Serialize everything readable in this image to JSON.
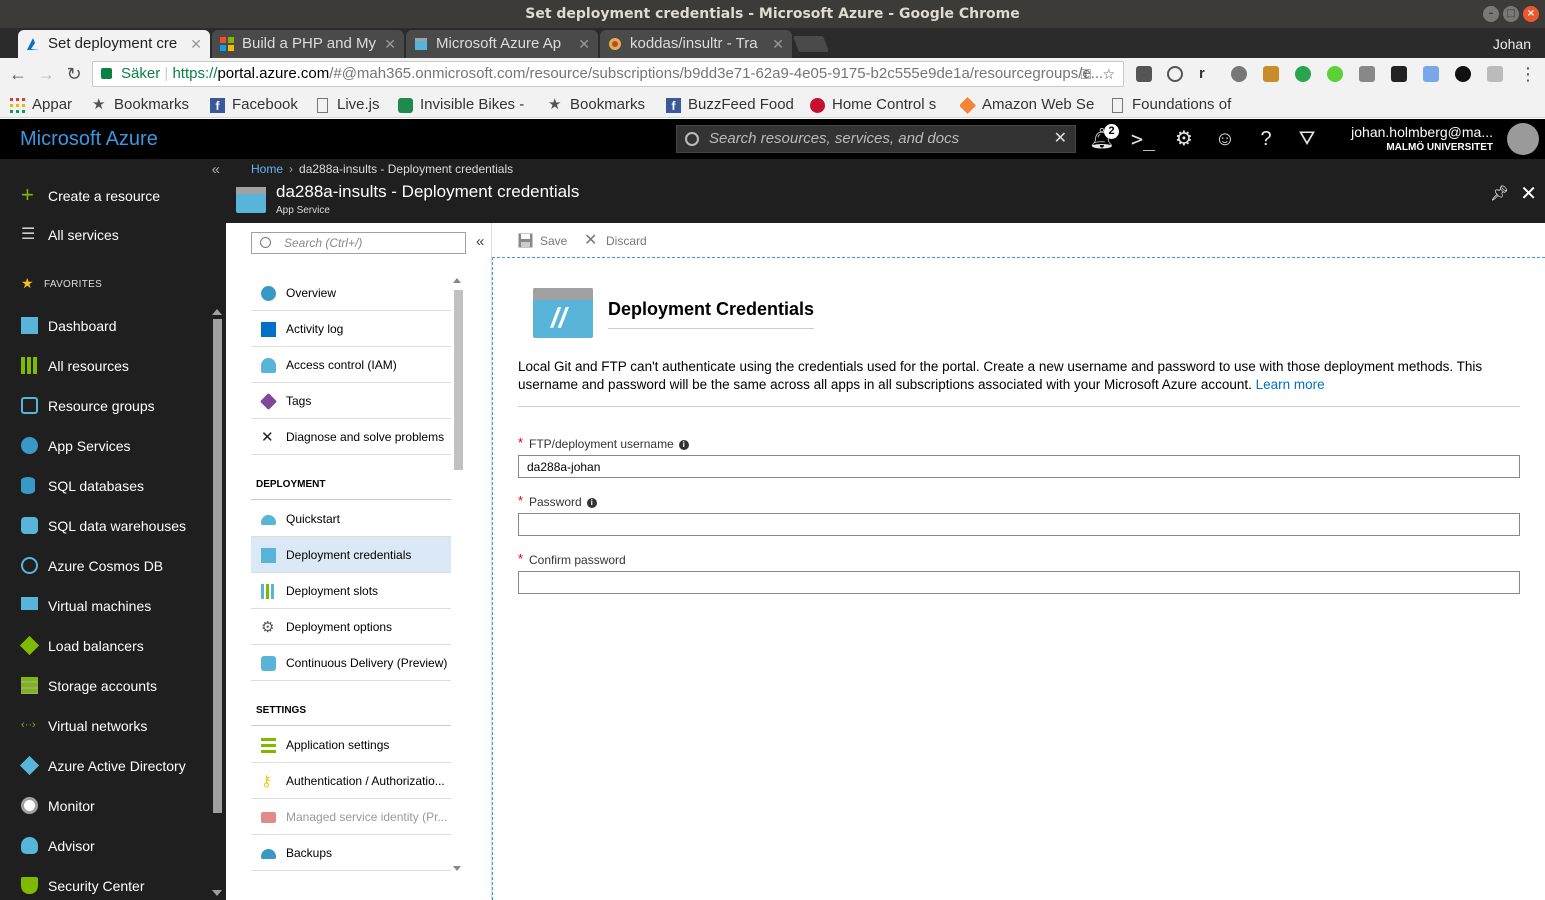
{
  "window": {
    "title": "Set deployment credentials - Microsoft Azure - Google Chrome"
  },
  "tabs": [
    {
      "label": "Set deployment cre",
      "active": true
    },
    {
      "label": "Build a PHP and My",
      "active": false
    },
    {
      "label": "Microsoft Azure Ap",
      "active": false
    },
    {
      "label": "koddas/insultr - Tra",
      "active": false
    }
  ],
  "profile": "Johan",
  "address": {
    "secure_label": "Säker",
    "scheme": "https://",
    "host": "portal.azure.com",
    "path": "/#@mah365.onmicrosoft.com/resource/subscriptions/b9dd3e71-62a9-4e05-9175-b2c555e9de1a/resourcegroups/e..."
  },
  "bookmarks": [
    {
      "label": "Appar",
      "icon": "apps-grid-icon"
    },
    {
      "label": "Bookmarks",
      "icon": "star-icon"
    },
    {
      "label": "Facebook",
      "icon": "facebook-icon"
    },
    {
      "label": "Live.js",
      "icon": "page-icon"
    },
    {
      "label": "Invisible Bikes - ",
      "icon": "invisible-bikes-icon"
    },
    {
      "label": "Bookmarks",
      "icon": "star-icon"
    },
    {
      "label": "BuzzFeed Food",
      "icon": "facebook-icon"
    },
    {
      "label": "Home Control s",
      "icon": "home-control-icon"
    },
    {
      "label": "Amazon Web Se",
      "icon": "aws-icon"
    },
    {
      "label": "Foundations of",
      "icon": "page-icon"
    }
  ],
  "azure": {
    "brand": "Microsoft Azure",
    "search_placeholder": "Search resources, services, and docs",
    "notification_count": "2",
    "user_email": "johan.holmberg@ma...",
    "user_org": "MALMÖ UNIVERSITET"
  },
  "leftnav": {
    "create": "Create a resource",
    "all_services": "All services",
    "favorites_label": "FAVORITES",
    "items": [
      "Dashboard",
      "All resources",
      "Resource groups",
      "App Services",
      "SQL databases",
      "SQL data warehouses",
      "Azure Cosmos DB",
      "Virtual machines",
      "Load balancers",
      "Storage accounts",
      "Virtual networks",
      "Azure Active Directory",
      "Monitor",
      "Advisor",
      "Security Center"
    ]
  },
  "breadcrumb": {
    "home": "Home",
    "current": "da288a-insults - Deployment credentials"
  },
  "blade": {
    "title": "da288a-insults - Deployment credentials",
    "subtitle": "App Service"
  },
  "resmenu": {
    "search_placeholder": "Search (Ctrl+/)",
    "top_items": [
      "Overview",
      "Activity log",
      "Access control (IAM)",
      "Tags",
      "Diagnose and solve problems"
    ],
    "deployment_header": "DEPLOYMENT",
    "deployment_items": [
      "Quickstart",
      "Deployment credentials",
      "Deployment slots",
      "Deployment options",
      "Continuous Delivery (Preview)"
    ],
    "settings_header": "SETTINGS",
    "settings_items": [
      "Application settings",
      "Authentication / Authorizatio...",
      "Managed service identity (Pr...",
      "Backups"
    ]
  },
  "content": {
    "save_label": "Save",
    "discard_label": "Discard",
    "heading": "Deployment Credentials",
    "description": "Local Git and FTP can't authenticate using the credentials used for the portal. Create a new username and password to use with those deployment methods. This username and password will be the same across all apps in all subscriptions associated with your Microsoft Azure account.",
    "learn_more": "Learn more",
    "username_label": "FTP/deployment username",
    "username_value": "da288a-johan",
    "password_label": "Password",
    "password_value": "",
    "confirm_label": "Confirm password",
    "confirm_value": ""
  },
  "colors": {
    "azure_blue": "#3b97e0",
    "selection": "#dbe9f7",
    "link": "#0072c6",
    "secure_green": "#0b8043"
  }
}
